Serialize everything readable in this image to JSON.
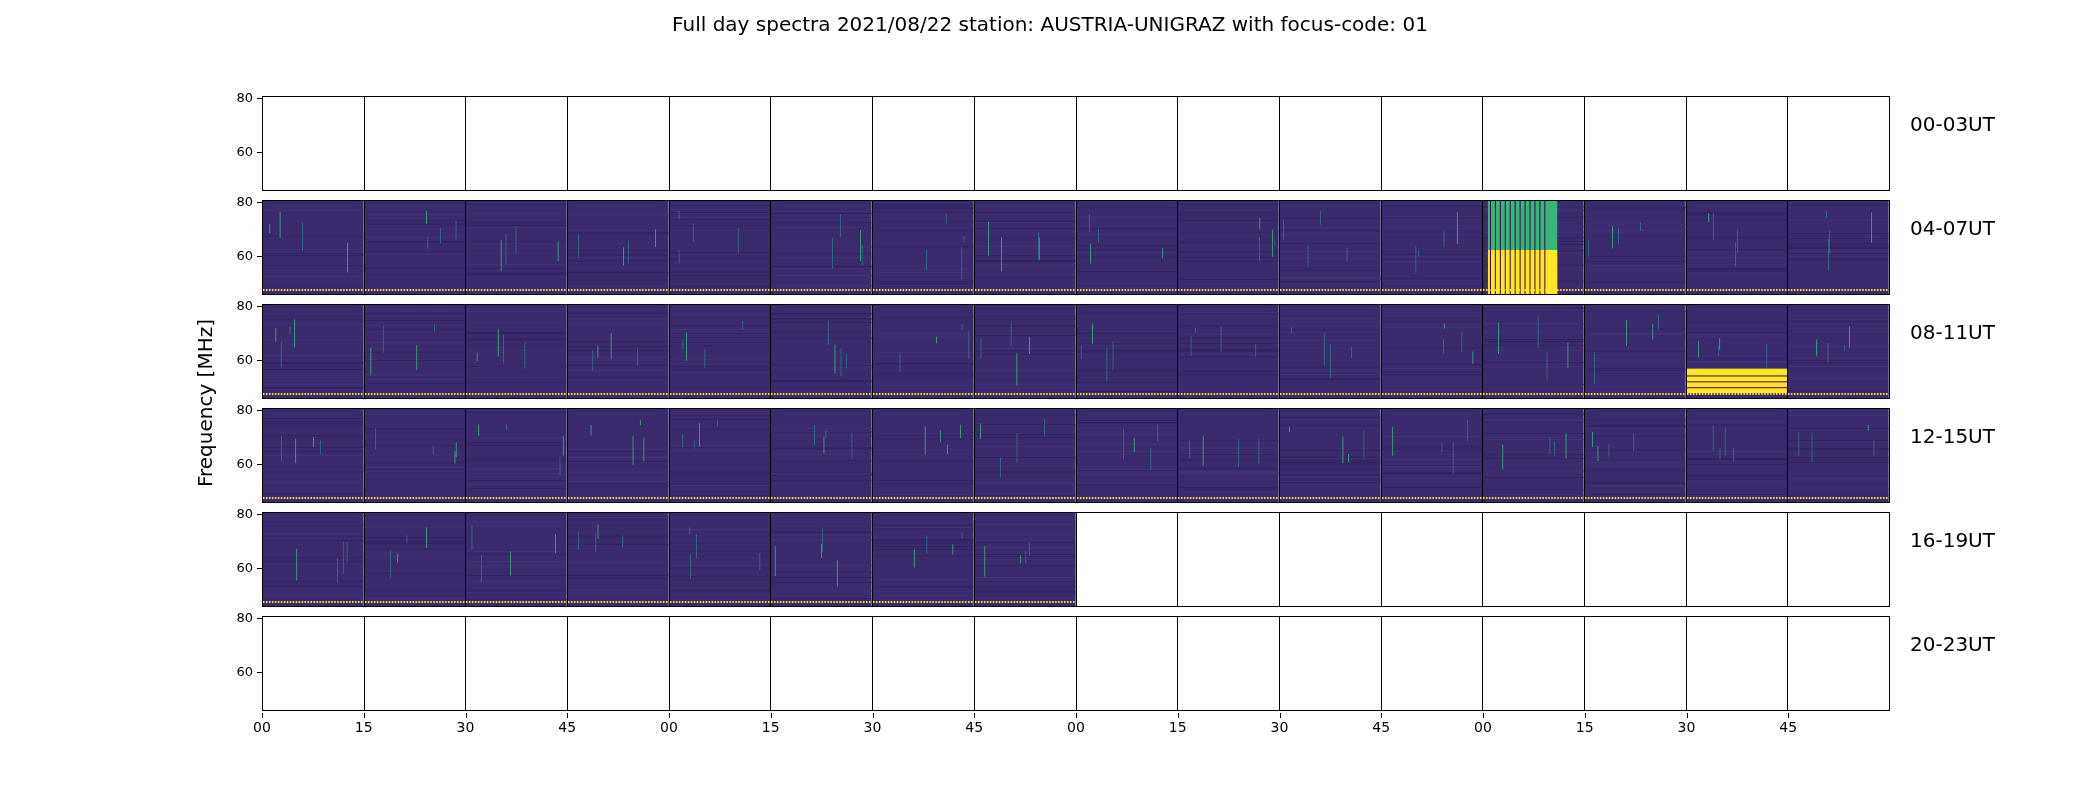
{
  "title": "Full day spectra 2021/08/22 station: AUSTRIA-UNIGRAZ with focus-code: 01",
  "ylabel": "Frequency [MHz]",
  "xticks": [
    "00",
    "15",
    "30",
    "45",
    "00",
    "15",
    "30",
    "45",
    "00",
    "15",
    "30",
    "45",
    "00",
    "15",
    "30",
    "45"
  ],
  "rows": [
    {
      "label": "00-03UT",
      "yticks": [
        "80",
        "60"
      ],
      "panels": [
        {
          "kind": "blank"
        },
        {
          "kind": "blank"
        },
        {
          "kind": "blank"
        },
        {
          "kind": "blank"
        },
        {
          "kind": "blank"
        },
        {
          "kind": "blank"
        },
        {
          "kind": "blank"
        },
        {
          "kind": "blank"
        },
        {
          "kind": "blank"
        },
        {
          "kind": "blank"
        },
        {
          "kind": "blank"
        },
        {
          "kind": "blank"
        },
        {
          "kind": "blank"
        },
        {
          "kind": "blank"
        },
        {
          "kind": "blank"
        },
        {
          "kind": "blank"
        }
      ]
    },
    {
      "label": "04-07UT",
      "yticks": [
        "80",
        "60"
      ],
      "panels": [
        {
          "kind": "spectrum"
        },
        {
          "kind": "spectrum"
        },
        {
          "kind": "spectrum"
        },
        {
          "kind": "spectrum"
        },
        {
          "kind": "spectrum"
        },
        {
          "kind": "spectrum"
        },
        {
          "kind": "spectrum"
        },
        {
          "kind": "spectrum"
        },
        {
          "kind": "spectrum"
        },
        {
          "kind": "spectrum"
        },
        {
          "kind": "spectrum"
        },
        {
          "kind": "spectrum"
        },
        {
          "kind": "burst"
        },
        {
          "kind": "spectrum"
        },
        {
          "kind": "spectrum"
        },
        {
          "kind": "spectrum"
        }
      ]
    },
    {
      "label": "08-11UT",
      "yticks": [
        "80",
        "60"
      ],
      "panels": [
        {
          "kind": "spectrum"
        },
        {
          "kind": "spectrum"
        },
        {
          "kind": "spectrum"
        },
        {
          "kind": "spectrum"
        },
        {
          "kind": "spectrum"
        },
        {
          "kind": "spectrum"
        },
        {
          "kind": "spectrum"
        },
        {
          "kind": "spectrum"
        },
        {
          "kind": "spectrum"
        },
        {
          "kind": "spectrum"
        },
        {
          "kind": "spectrum"
        },
        {
          "kind": "spectrum"
        },
        {
          "kind": "spectrum"
        },
        {
          "kind": "spectrum"
        },
        {
          "kind": "partial_burst"
        },
        {
          "kind": "spectrum"
        }
      ]
    },
    {
      "label": "12-15UT",
      "yticks": [
        "80",
        "60"
      ],
      "panels": [
        {
          "kind": "spectrum"
        },
        {
          "kind": "spectrum"
        },
        {
          "kind": "spectrum"
        },
        {
          "kind": "spectrum"
        },
        {
          "kind": "spectrum"
        },
        {
          "kind": "spectrum"
        },
        {
          "kind": "spectrum"
        },
        {
          "kind": "spectrum"
        },
        {
          "kind": "spectrum"
        },
        {
          "kind": "spectrum"
        },
        {
          "kind": "spectrum"
        },
        {
          "kind": "spectrum"
        },
        {
          "kind": "spectrum"
        },
        {
          "kind": "spectrum"
        },
        {
          "kind": "spectrum"
        },
        {
          "kind": "spectrum"
        }
      ]
    },
    {
      "label": "16-19UT",
      "yticks": [
        "80",
        "60"
      ],
      "panels": [
        {
          "kind": "spectrum"
        },
        {
          "kind": "spectrum"
        },
        {
          "kind": "spectrum"
        },
        {
          "kind": "spectrum"
        },
        {
          "kind": "spectrum"
        },
        {
          "kind": "spectrum"
        },
        {
          "kind": "spectrum"
        },
        {
          "kind": "spectrum"
        },
        {
          "kind": "blank"
        },
        {
          "kind": "blank"
        },
        {
          "kind": "blank"
        },
        {
          "kind": "blank"
        },
        {
          "kind": "blank"
        },
        {
          "kind": "blank"
        },
        {
          "kind": "blank"
        },
        {
          "kind": "blank"
        }
      ]
    },
    {
      "label": "20-23UT",
      "yticks": [
        "80",
        "60"
      ],
      "panels": [
        {
          "kind": "blank"
        },
        {
          "kind": "blank"
        },
        {
          "kind": "blank"
        },
        {
          "kind": "blank"
        },
        {
          "kind": "blank"
        },
        {
          "kind": "blank"
        },
        {
          "kind": "blank"
        },
        {
          "kind": "blank"
        },
        {
          "kind": "blank"
        },
        {
          "kind": "blank"
        },
        {
          "kind": "blank"
        },
        {
          "kind": "blank"
        },
        {
          "kind": "blank"
        },
        {
          "kind": "blank"
        },
        {
          "kind": "blank"
        },
        {
          "kind": "blank"
        }
      ]
    }
  ]
}
